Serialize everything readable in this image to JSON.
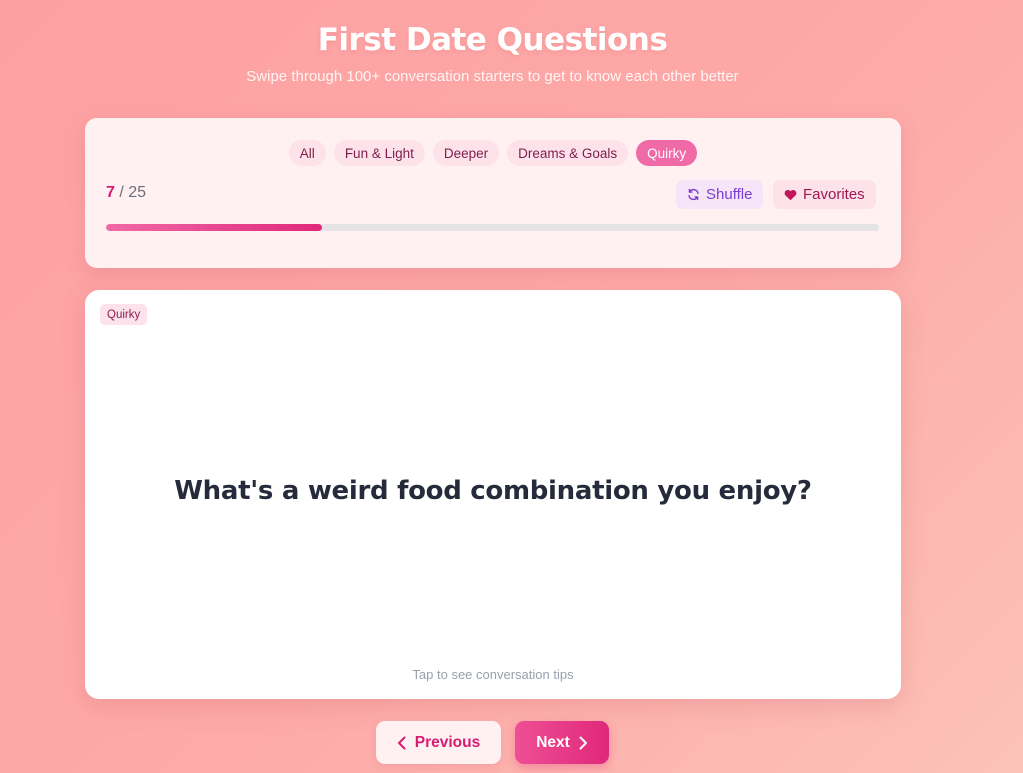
{
  "header": {
    "title": "First Date Questions",
    "subtitle": "Swipe through 100+ conversation starters to get to know each other better"
  },
  "filters": [
    {
      "label": "All",
      "active": false
    },
    {
      "label": "Fun & Light",
      "active": false
    },
    {
      "label": "Deeper",
      "active": false
    },
    {
      "label": "Dreams & Goals",
      "active": false
    },
    {
      "label": "Quirky",
      "active": true
    }
  ],
  "progress": {
    "current": "7",
    "separator": "/",
    "total": "25",
    "fraction": 0.28
  },
  "actions": {
    "shuffle_label": "Shuffle",
    "shuffle_icon": "refresh-icon",
    "favorites_label": "Favorites",
    "favorites_icon": "heart-icon"
  },
  "card": {
    "category_tag": "Quirky",
    "question": "What's a weird food combination you enjoy?",
    "hint": "Tap to see conversation tips"
  },
  "navigation": {
    "previous_label": "Previous",
    "previous_icon": "chevron-left-icon",
    "next_label": "Next",
    "next_icon": "chevron-right-icon"
  },
  "colors": {
    "accent": "#e0287a",
    "active_pill": "#f06aa7",
    "shuffle_text": "#7b3dd1"
  }
}
